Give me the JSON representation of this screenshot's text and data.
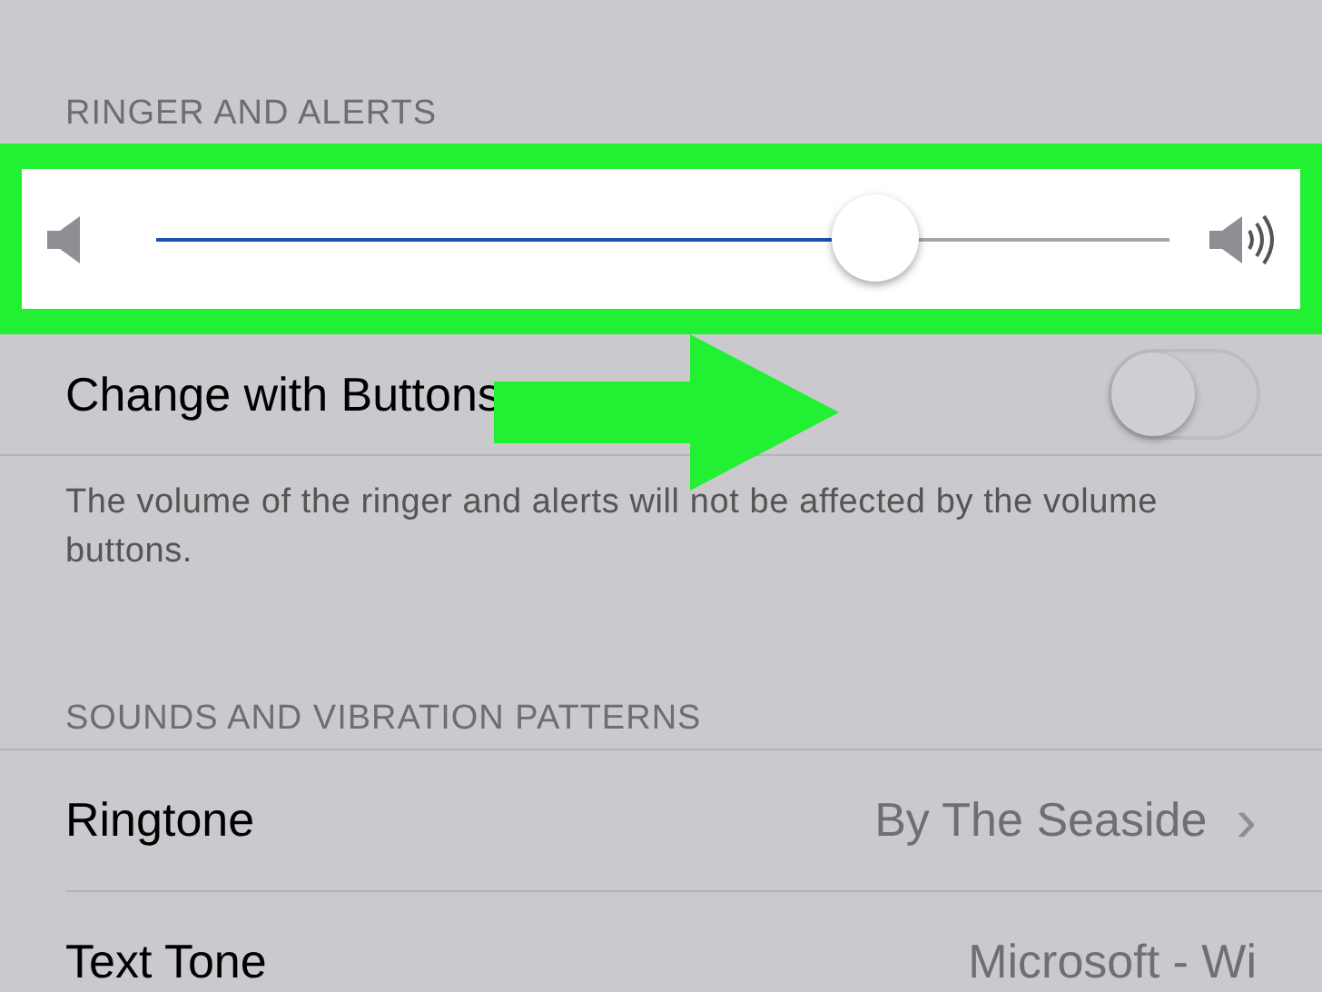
{
  "ringer_section": {
    "header": "RINGER AND ALERTS",
    "volume_slider": {
      "level": 0.71
    },
    "change_with_buttons": {
      "label": "Change with Buttons",
      "on": false
    },
    "footer": "The volume of the ringer and alerts will not be affected by the volume buttons."
  },
  "sounds_section": {
    "header": "SOUNDS AND VIBRATION PATTERNS",
    "rows": [
      {
        "label": "Ringtone",
        "value": "By The Seaside",
        "chevron": "›"
      },
      {
        "label": "Text Tone",
        "value": "Microsoft - Wi"
      }
    ]
  }
}
